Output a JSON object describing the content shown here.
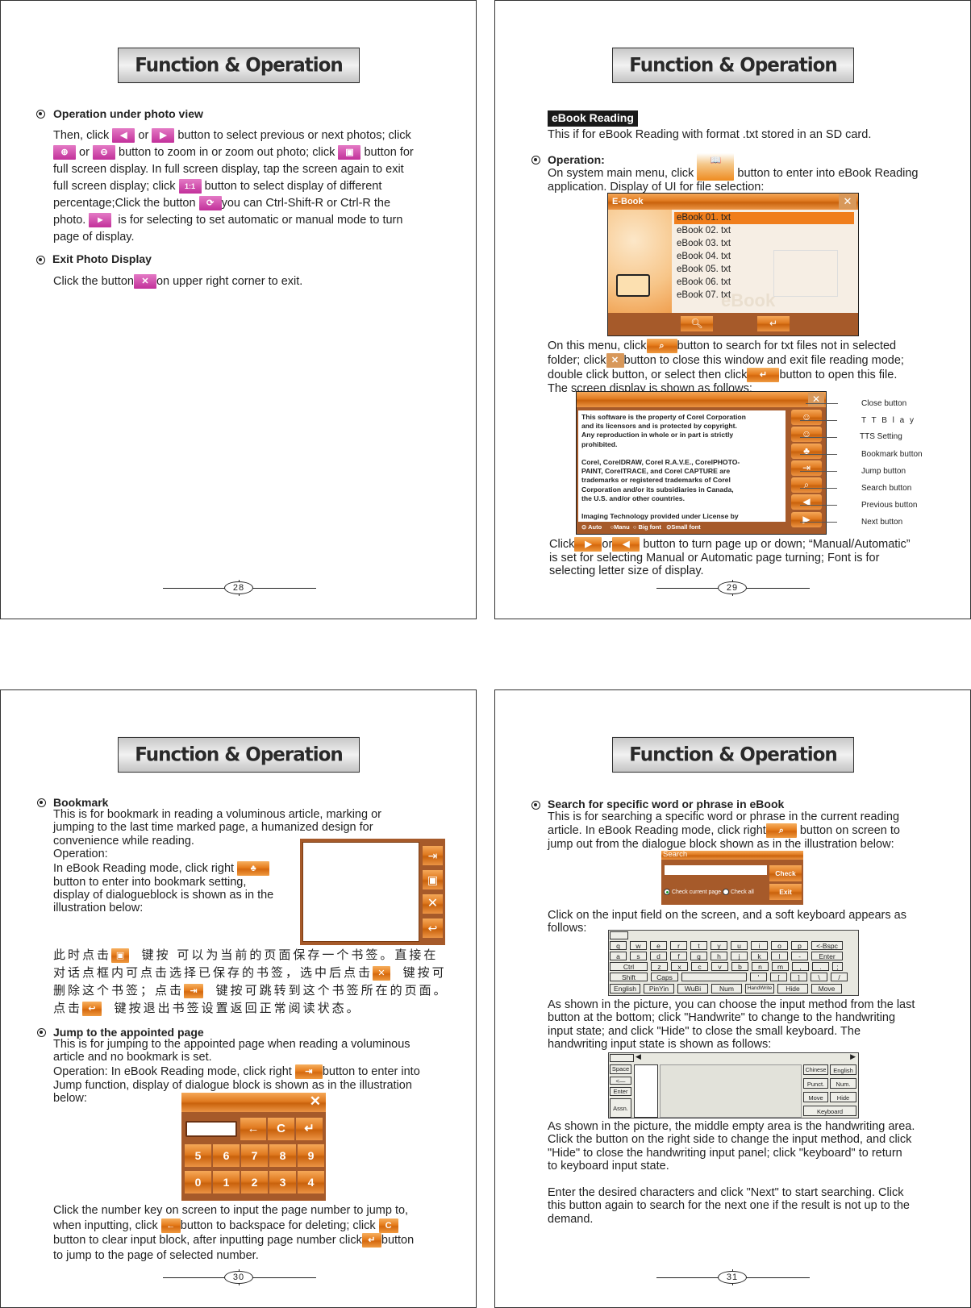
{
  "header_title": "Function & Operation",
  "page28": {
    "number": "28",
    "section1_title": "Operation under photo view",
    "section1_lines": [
      [
        "Then, click",
        "or",
        "button to select previous or next photos; click"
      ],
      [
        "or",
        "button to zoom in or zoom out photo; click",
        "button for"
      ],
      [
        "full screen display. In full screen display, tap the screen again to exit"
      ],
      [
        "full screen display; click",
        "button to select display of different"
      ],
      [
        "percentage;Click the button",
        "you can Ctrl-Shift-R or Ctrl-R the"
      ],
      [
        "photo.",
        "is for selecting to set automatic or manual mode to turn"
      ],
      [
        "page of display."
      ]
    ],
    "icons": {
      "prev": "◀",
      "next": "▶",
      "zoom_in": "⊕",
      "zoom_out": "⊖",
      "fullscreen": "▣",
      "ratio": "1:1",
      "rotate": "⟳",
      "auto": "▶",
      "close": "✕"
    },
    "section2_title": "Exit Photo Display",
    "section2_text": [
      "Click the button",
      "on upper right corner to exit."
    ]
  },
  "page29": {
    "number": "29",
    "badge": "eBook Reading",
    "intro": "This if for eBook Reading with format .txt stored in an SD card.",
    "op_title": "Operation:",
    "op_text_a": "On system main menu, click",
    "op_text_b": "button to enter into eBook Reading",
    "op_text_c": "application. Display of UI for file selection:",
    "ebook_window": {
      "title": "E-Book",
      "files": [
        "eBook 01. txt",
        "eBook 02. txt",
        "eBook 03. txt",
        "eBook 04. txt",
        "eBook 05. txt",
        "eBook 06. txt",
        "eBook 07. txt"
      ],
      "selected_index": 0,
      "watermark": "eBook"
    },
    "menu_text": [
      [
        "On this menu, click",
        "button to search for txt files not in selected"
      ],
      [
        "folder; click",
        "button to close this window and exit file reading mode;"
      ],
      [
        "double click button, or select then click",
        "button to open this file."
      ],
      [
        "The screen display is shown as follows:"
      ]
    ],
    "reader": {
      "content": [
        "This software is the property of Corel Corporation",
        "and its licensors and is protected by copyright.",
        "Any reproduction in whole or in part is strictly",
        "prohibited.",
        "",
        "Corel, CorelDRAW, Corel R.A.V.E., CorelPHOTO-",
        "PAINT, CorelTRACE, and Corel CAPTURE are",
        "trademarks or registered trademarks of Corel",
        "Corporation and/or its subsidiaries in Canada,",
        "the U.S. and/or other countries.",
        "",
        "Imaging Technology provided under License by"
      ],
      "options": [
        {
          "label": "Auto",
          "checked": true
        },
        {
          "label": "Manu",
          "checked": false
        },
        {
          "label": "Big font",
          "checked": false
        },
        {
          "label": "Small font",
          "checked": true
        }
      ],
      "callouts": [
        "Close button",
        "T T B l a y",
        "TTS Setting",
        "Bookmark button",
        "Jump button",
        "Search button",
        "Previous button",
        "Next button"
      ]
    },
    "footer_text": [
      [
        "Click",
        "or",
        "button to turn page up or down; “Manual/Automatic”"
      ],
      [
        " is set for selecting Manual or Automatic page turning; Font is for"
      ],
      [
        "selecting letter size of display."
      ]
    ]
  },
  "page30": {
    "number": "30",
    "bookmark_title": "Bookmark",
    "bookmark_lines": [
      "This is for bookmark in reading a voluminous article, marking or",
      "jumping to the last time marked page, a humanized design for",
      "convenience while reading.",
      "Operation:",
      "In eBook Reading mode, click right",
      "button to enter into bookmark setting,",
      "display of dialogueblock is shown as in the",
      "illustration below:"
    ],
    "chinese_lines": [
      [
        "此时点击",
        "键按 可以为当前的页面保存一个书签。直接在"
      ],
      [
        "对话点框内可点击选择已保存的书签，选中后点击",
        "键按可"
      ],
      [
        "删除这个书签；点击",
        "键按可跳转到这个书签所在的页面。"
      ],
      [
        "点击",
        "键按退出书签设置返回正常阅读状态。"
      ]
    ],
    "jump_title": "Jump to the appointed page",
    "jump_lines": [
      "This is for jumping to the appointed page when reading a voluminous",
      "article and no bookmark is set.",
      "Operation: In eBook Reading mode, click right",
      "button to enter into",
      "Jump function, display of dialogue block is shown as in the illustration",
      "below:"
    ],
    "keypad": {
      "row1": [
        "←",
        "C",
        "↵"
      ],
      "row2": [
        "5",
        "6",
        "7",
        "8",
        "9"
      ],
      "row3": [
        "0",
        "1",
        "2",
        "3",
        "4"
      ],
      "close": "✕"
    },
    "after_lines": [
      [
        "Click the number key on screen to input the page number to jump to,"
      ],
      [
        "when inputting, click",
        "button to backspace for deleting; click"
      ],
      [
        "button to clear input block, after inputting page number click",
        "button"
      ],
      [
        "to jump to the page of selected number."
      ]
    ]
  },
  "page31": {
    "number": "31",
    "title": "Search for specific word or phrase in eBook",
    "intro_lines": [
      [
        "This is for searching a specific word or phrase in the current reading"
      ],
      [
        "article. In eBook Reading mode, click right",
        "button on screen to"
      ],
      [
        " jump out from the dialogue block shown as in the illustration below:"
      ]
    ],
    "search_dialog": {
      "title": "Search",
      "input_value": "",
      "check": "Check",
      "exit": "Exit",
      "opt1": "Check current page",
      "opt2": "Check all"
    },
    "kb_intro": [
      "Click on the input field on the screen, and a soft keyboard appears as",
      "follows:"
    ],
    "keyboard": {
      "row1": [
        "q",
        "w",
        "e",
        "r",
        "t",
        "y",
        "u",
        "i",
        "o",
        "p",
        "<-Bspc"
      ],
      "row2": [
        "a",
        "s",
        "d",
        "f",
        "g",
        "h",
        "j",
        "k",
        "l",
        "-",
        "Enter"
      ],
      "row3": [
        "Ctrl",
        "z",
        "x",
        "c",
        "v",
        "b",
        "n",
        "m",
        ",",
        ".",
        ";"
      ],
      "row4": [
        "Shift",
        "Caps",
        "",
        "'",
        "[",
        "]",
        "\\",
        "/"
      ],
      "row5": [
        "English",
        "PinYin",
        "WuBi",
        "Num",
        "HandWrite",
        "Hide",
        "Move"
      ]
    },
    "kb_after": [
      "As shown in the picture, you can choose the input method from the last",
      "button at the bottom; click \"Handwrite\" to change to the handwriting",
      "input state; and click \"Hide\" to close the small keyboard. The",
      "handwriting input state is shown as follows:"
    ],
    "handwrite": {
      "left": [
        "Space",
        "<—",
        "Enter",
        "Assn."
      ],
      "right": [
        "Chinese",
        "English",
        "Punct.",
        "Num.",
        "Move",
        "Hide",
        "Keyboard"
      ]
    },
    "hw_after": [
      "As shown in the picture, the middle empty area is the handwriting area.",
      "Click the button on the right side to change the input method, and click",
      "\"Hide\" to close the handwriting input panel; click \"keyboard\" to return",
      "to keyboard input state.",
      "",
      "Enter the desired characters and click \"Next\" to start searching. Click",
      "this button again to search for the next one if the result is not up to the",
      "demand."
    ]
  }
}
